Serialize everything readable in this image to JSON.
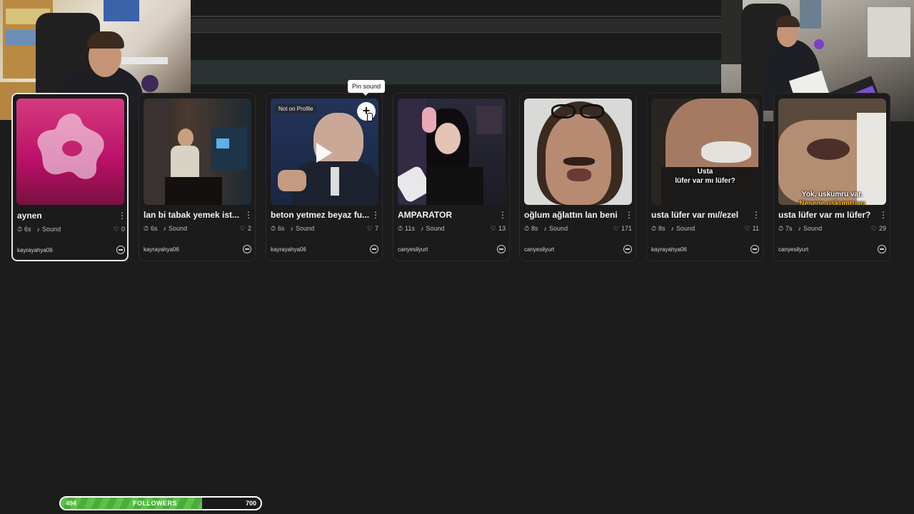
{
  "tooltip": "Pin sound",
  "cards": [
    {
      "title": "aynen",
      "duration": "6s",
      "type": "Sound",
      "likes": "0",
      "author": "kayrayahya06",
      "selected": true
    },
    {
      "title": "lan bi tabak yemek ist...",
      "duration": "6s",
      "type": "Sound",
      "likes": "2",
      "author": "kayrayahya06"
    },
    {
      "title": "beton yetmez beyaz fu...",
      "duration": "6s",
      "type": "Sound",
      "likes": "7",
      "author": "kayrayahya06",
      "badge": "Not on Profile"
    },
    {
      "title": "AMPARATOR",
      "duration": "11s",
      "type": "Sound",
      "likes": "13",
      "author": "canyesilyurt"
    },
    {
      "title": "oğlum ağlattın lan beni",
      "duration": "8s",
      "type": "Sound",
      "likes": "171",
      "author": "canyesilyurt"
    },
    {
      "title": "usta lüfer var mı//ezel",
      "duration": "8s",
      "type": "Sound",
      "likes": "11",
      "author": "kayrayahya06",
      "overlay": [
        "Usta",
        "lüfer var mı lüfer?"
      ]
    },
    {
      "title": "usta lüfer var mı lüfer?",
      "duration": "7s",
      "type": "Sound",
      "likes": "29",
      "author": "canyesilyurt",
      "overlay": [
        "Yok, uskumru var.",
        "Nesene uskumruyu"
      ]
    }
  ],
  "followers": {
    "current": "494",
    "label": "FOLLOWERS",
    "goal": "700",
    "progress": 0.706
  },
  "colors": {
    "accent_green": "#5ec247",
    "background": "#1c1c1d"
  }
}
